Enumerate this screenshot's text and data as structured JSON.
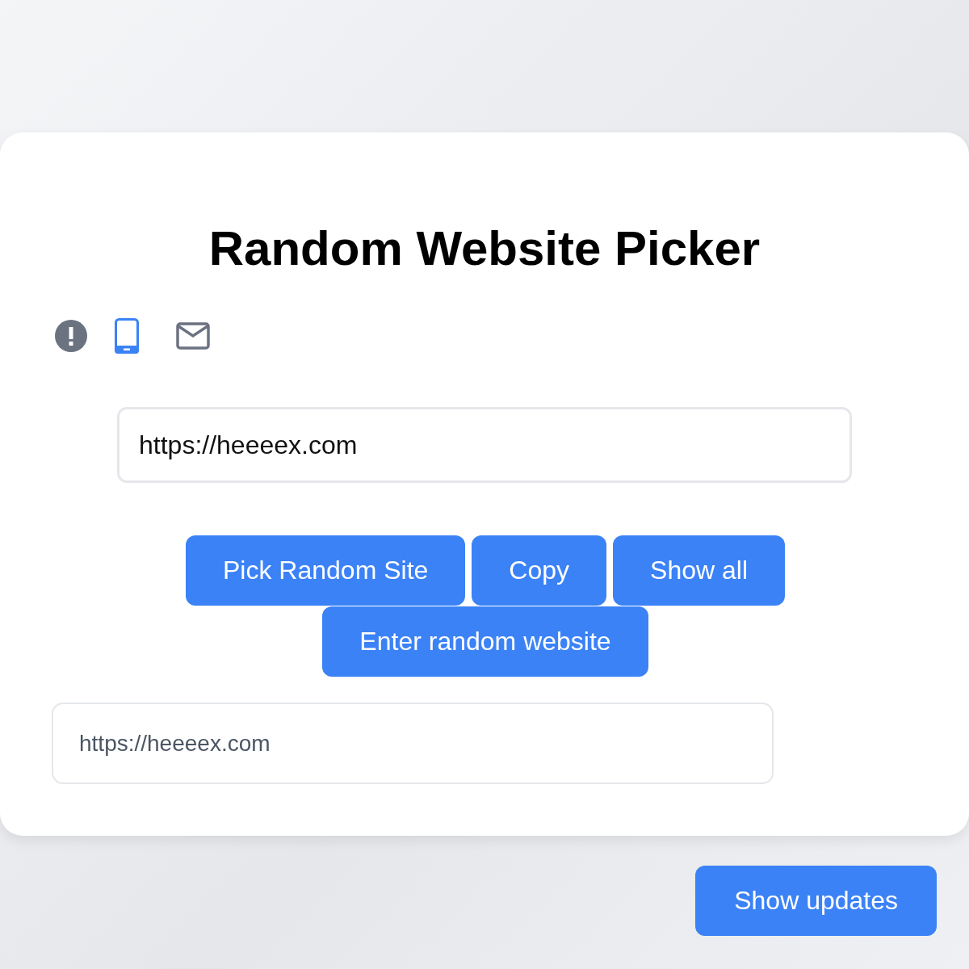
{
  "title": "Random Website Picker",
  "modes": [
    {
      "kind": "alert",
      "selected": false
    },
    {
      "kind": "phone",
      "selected": true
    },
    {
      "kind": "mail",
      "selected": false
    }
  ],
  "url_field": {
    "value": "https://heeeex.com"
  },
  "buttons": [
    "Pick Random Site",
    "Copy",
    "Show all",
    "Enter random website"
  ],
  "result_field": {
    "value": "https://heeeex.com"
  },
  "footer_button": "Show updates"
}
